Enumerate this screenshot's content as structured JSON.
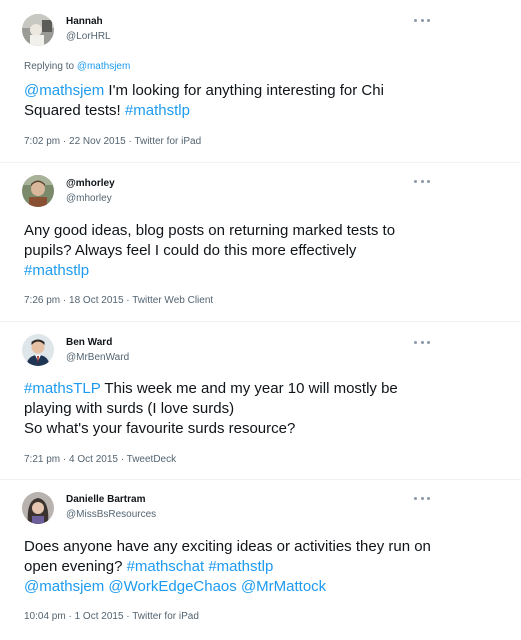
{
  "tweets": [
    {
      "name": "Hannah",
      "handle": "@LorHRL",
      "replying_label": "Replying to",
      "replying_to": "@mathsjem",
      "body": [
        {
          "t": "@mathsjem",
          "link": true
        },
        {
          "t": " I'm looking for anything interesting for Chi Squared tests! ",
          "link": false
        },
        {
          "t": "#mathstlp",
          "link": true
        }
      ],
      "time": "7:02 pm · 22 Nov 2015 · Twitter for iPad"
    },
    {
      "name": "@mhorley",
      "handle": "@mhorley",
      "body": [
        {
          "t": "Any good ideas, blog posts on returning marked tests to pupils?  Always feel I could do this more effectively ",
          "link": false
        },
        {
          "t": "#mathstlp",
          "link": true
        }
      ],
      "time": "7:26 pm · 18 Oct 2015 · Twitter Web Client"
    },
    {
      "name": "Ben Ward",
      "handle": "@MrBenWard",
      "body": [
        {
          "t": "#mathsTLP",
          "link": true
        },
        {
          "t": " This week me and my year 10 will mostly be playing with surds (I love surds)",
          "link": false
        },
        {
          "br": true
        },
        {
          "t": "So what's your favourite surds resource?",
          "link": false
        }
      ],
      "time": "7:21 pm · 4 Oct 2015 · TweetDeck"
    },
    {
      "name": "Danielle Bartram",
      "handle": "@MissBsResources",
      "body": [
        {
          "t": "Does anyone have any exciting ideas or activities they run on open evening? ",
          "link": false
        },
        {
          "t": "#mathschat",
          "link": true
        },
        {
          "t": " ",
          "link": false
        },
        {
          "t": "#mathstlp",
          "link": true
        },
        {
          "br": true
        },
        {
          "t": "@mathsjem",
          "link": true
        },
        {
          "t": " ",
          "link": false
        },
        {
          "t": "@WorkEdgeChaos",
          "link": true
        },
        {
          "t": " ",
          "link": false
        },
        {
          "t": "@MrMattock",
          "link": true
        }
      ],
      "time": "10:04 pm · 1 Oct 2015 · Twitter for iPad"
    }
  ],
  "colors": {
    "link": "#1d9bf0",
    "secondary_text": "#536471",
    "primary_text": "#0f1419"
  },
  "icons": [
    "more-icon"
  ]
}
